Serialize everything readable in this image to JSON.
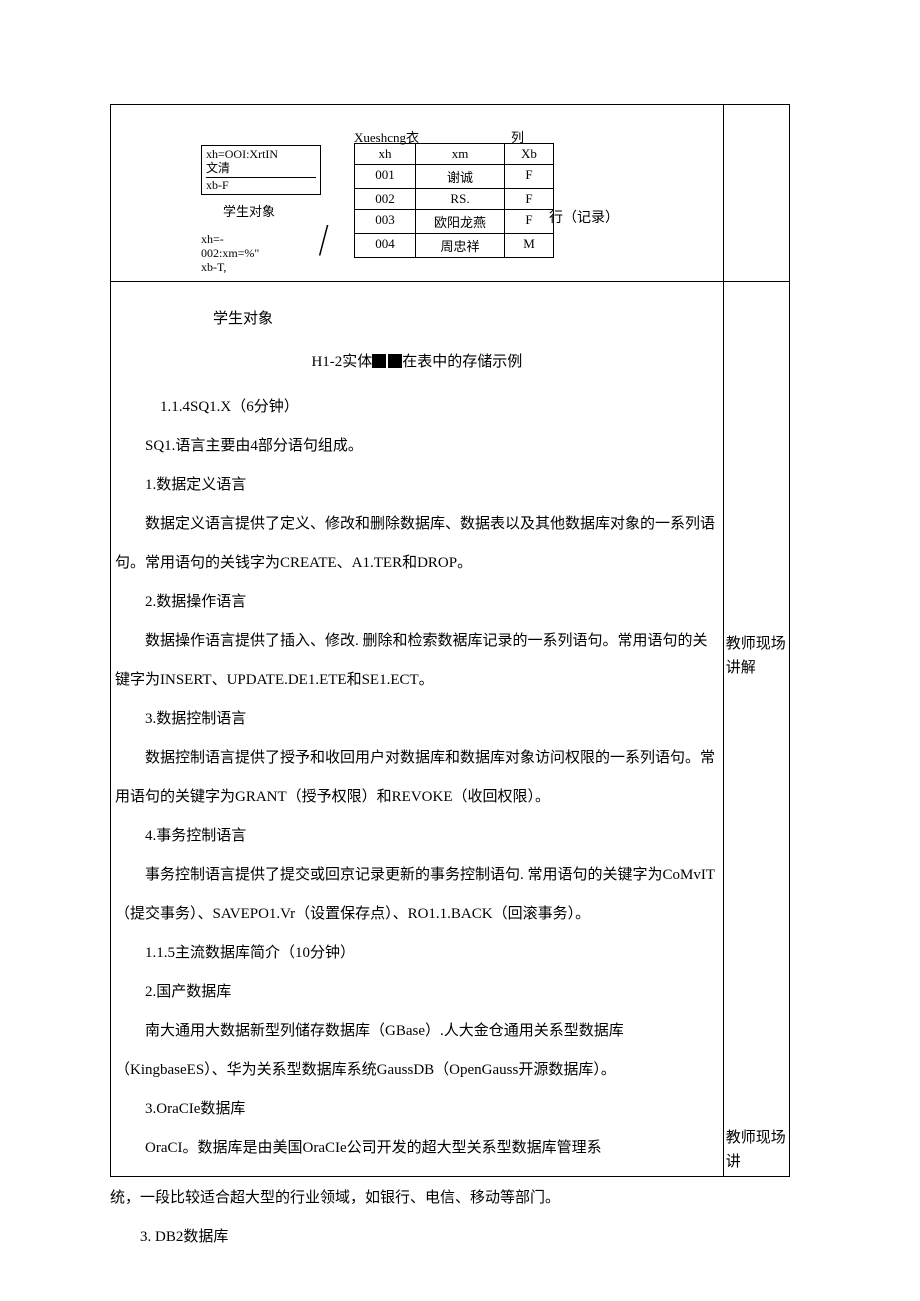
{
  "figure": {
    "obj1_line1": "xh=OOI:XrtIN",
    "obj1_line2": "文清",
    "obj1_line3": "xb-F",
    "obj_label": "学生对象",
    "obj2_line1": "xh=-",
    "obj2_line2": "002:xm=%\"",
    "obj2_line3": "xb-T,",
    "tbl_title": "Xueshcng衣",
    "tbl_col": "列",
    "tbl_row": "行（记录）",
    "headers": [
      "xh",
      "xm",
      "Xb"
    ],
    "rows": [
      [
        "001",
        "谢诚",
        "F"
      ],
      [
        "002",
        "RS.",
        "F"
      ],
      [
        "003",
        "欧阳龙燕",
        "F"
      ],
      [
        "004",
        "周忠祥",
        "M"
      ]
    ]
  },
  "body": {
    "student_obj": "学生对象",
    "caption": "H1-2实体在表中的存储示例",
    "s114": "1.1.4SQ1.X（6分钟）",
    "p1": "SQ1.语言主要由4部分语句组成。",
    "h1": "1.数据定义语言",
    "p2": "数据定义语言提供了定义、修改和删除数据库、数据表以及其他数据库对象的一系列语句。常用语句的关钱字为CREATE、A1.TER和DROP。",
    "h2": "2.数据操作语言",
    "p3": "数据操作语言提供了插入、修改. 删除和检索数裾库记录的一系列语句。常用语句的关键字为INSERT、UPDATE.DE1.ETE和SE1.ECT。",
    "h3": "3.数据控制语言",
    "p4": "数据控制语言提供了授予和收回用户对数据库和数据库对象访问权限的一系列语句。常用语句的关键字为GRANT（授予权限）和REVOKE（收回权限）。",
    "h4": "4.事务控制语言",
    "p5": "事务控制语言提供了提交或回京记录更新的事务控制语句. 常用语句的关键字为CoMvIT（提交事务）、SAVEPO1.Vr（设置保存点）、RO1.1.BACK（回滚事务）。",
    "s115": "1.1.5主流数据库简介（10分钟）",
    "h5": "2.国产数据库",
    "p6": "南大通用大数据新型列储存数据库（GBase）.人大金仓通用关系型数据库（KingbaseES）、华为关系型数据库系统GaussDB（OpenGauss开源数据库）。",
    "h6": "3.OraCIe数据库",
    "p7": "OraCI。数据库是由美国OraCIe公司开发的超大型关系型数据库管理系"
  },
  "side": {
    "note1": "教师现场讲解",
    "note2": "教师现场讲"
  },
  "below": {
    "p1": "统，一段比较适合超大型的行业领域，如银行、电信、移动等部门。",
    "p2": "3.   DB2数据库"
  }
}
